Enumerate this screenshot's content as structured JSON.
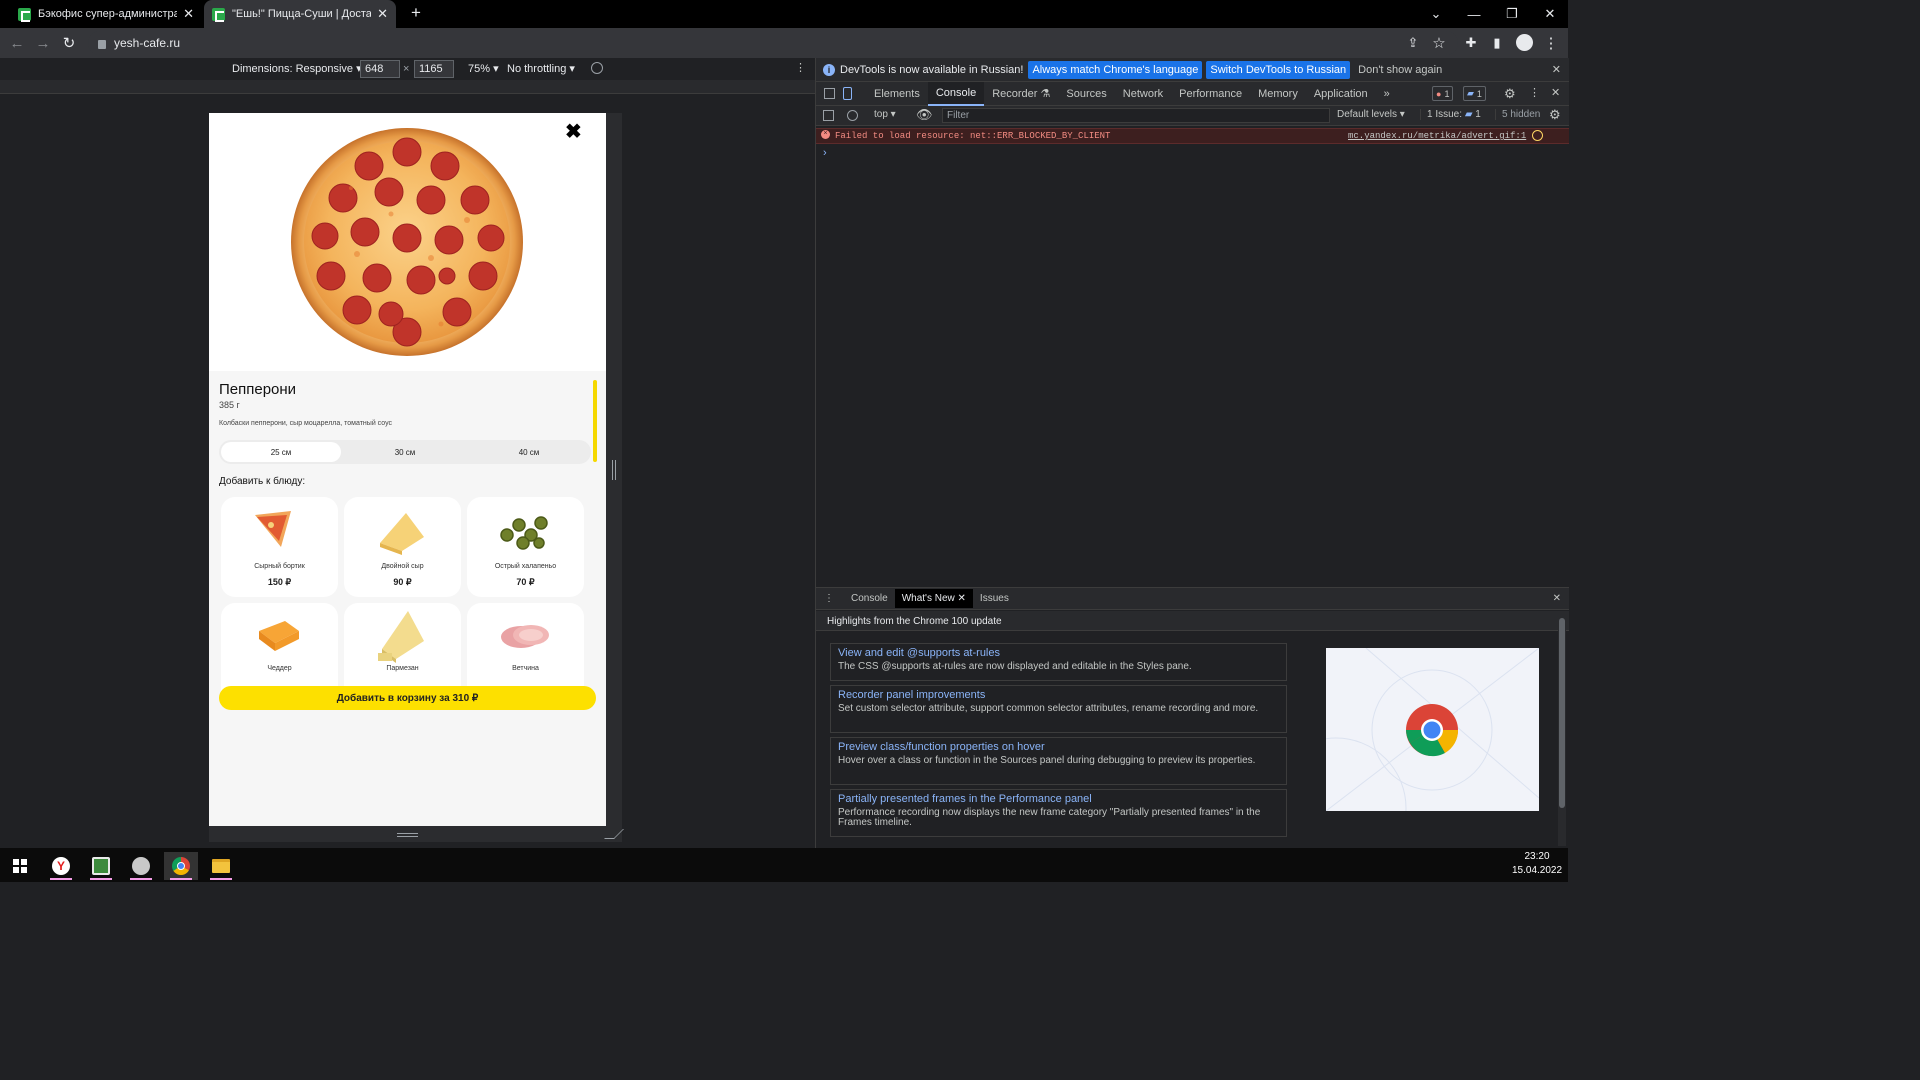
{
  "browser": {
    "tabs": [
      {
        "title": "Бэкофис супер-администратора",
        "active": false
      },
      {
        "title": "\"Ешь!\" Пицца-Суши | Доставка",
        "active": true
      }
    ],
    "url": "yesh-cafe.ru"
  },
  "device_toolbar": {
    "dimensions_label": "Dimensions: Responsive",
    "width": "648",
    "x_sep": "×",
    "height": "1165",
    "zoom": "75%",
    "throttling": "No throttling"
  },
  "product": {
    "name": "Пепперони",
    "weight": "385 г",
    "description": "Колбаски пепперони, сыр моцарелла, томатный соус",
    "sizes": [
      "25 см",
      "30 см",
      "40 см"
    ],
    "selected_size_index": 0,
    "addons_title": "Добавить к блюду:",
    "addons": [
      {
        "name": "Сырный бортик",
        "price": "150 ₽"
      },
      {
        "name": "Двойной сыр",
        "price": "90 ₽"
      },
      {
        "name": "Острый халапеньо",
        "price": "70 ₽"
      },
      {
        "name": "Чеддер",
        "price": ""
      },
      {
        "name": "Пармезан",
        "price": ""
      },
      {
        "name": "Ветчина",
        "price": ""
      }
    ],
    "cart_button": "Добавить в корзину за 310 ₽"
  },
  "devtools": {
    "infobar": {
      "message": "DevTools is now available in Russian!",
      "btn_match": "Always match Chrome's language",
      "btn_switch": "Switch DevTools to Russian",
      "btn_dismiss": "Don't show again"
    },
    "tabs": [
      "Elements",
      "Console",
      "Recorder",
      "Sources",
      "Network",
      "Performance",
      "Memory",
      "Application"
    ],
    "active_tab": "Console",
    "error_count": "1",
    "message_count": "1",
    "console": {
      "context": "top",
      "filter_placeholder": "Filter",
      "levels": "Default levels",
      "issues": "1 Issue:",
      "issues_count": "1",
      "hidden": "5 hidden",
      "error_text": "Failed to load resource: net::ERR_BLOCKED_BY_CLIENT",
      "error_source": "mc.yandex.ru/metrika/advert.gif:1"
    },
    "drawer": {
      "tabs": [
        "Console",
        "What's New",
        "Issues"
      ],
      "active_tab": "What's New",
      "heading": "Highlights from the Chrome 100 update",
      "items": [
        {
          "title": "View and edit @supports at-rules",
          "desc": "The CSS @supports at-rules are now displayed and editable in the Styles pane."
        },
        {
          "title": "Recorder panel improvements",
          "desc": "Set custom selector attribute, support common selector attributes, rename recording and more."
        },
        {
          "title": "Preview class/function properties on hover",
          "desc": "Hover over a class or function in the Sources panel during debugging to preview its properties."
        },
        {
          "title": "Partially presented frames in the Performance panel",
          "desc": "Performance recording now displays the new frame category \"Partially presented frames\" in the Frames timeline."
        }
      ]
    }
  },
  "taskbar": {
    "time": "23:20",
    "date": "15.04.2022"
  },
  "colors": {
    "accent_yellow": "#fde000",
    "devtools_blue": "#1a73e8",
    "error_red": "#f28b82"
  }
}
